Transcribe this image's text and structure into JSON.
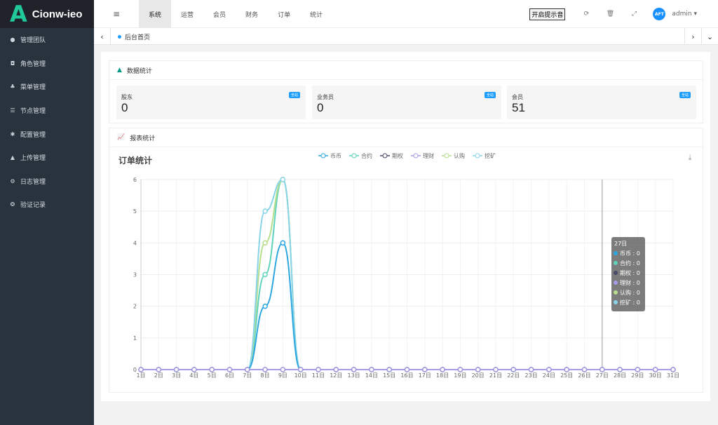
{
  "brand": {
    "mark": "A",
    "name": "Cionw-ieo",
    "color": "#20c997"
  },
  "sidebar": {
    "items": [
      {
        "label": "管理团队",
        "icon": "user-icon",
        "glyph": "●"
      },
      {
        "label": "角色管理",
        "icon": "id-card-icon",
        "glyph": "◘"
      },
      {
        "label": "菜单管理",
        "icon": "tree-icon",
        "glyph": "♣"
      },
      {
        "label": "节点管理",
        "icon": "list-icon",
        "glyph": "☰"
      },
      {
        "label": "配置管理",
        "icon": "asterisk-icon",
        "glyph": "✱"
      },
      {
        "label": "上传管理",
        "icon": "upload-arrow-icon",
        "glyph": "▲"
      },
      {
        "label": "日志管理",
        "icon": "gear-icon",
        "glyph": "⚙"
      },
      {
        "label": "验证记录",
        "icon": "dribbble-icon",
        "glyph": "❂"
      }
    ]
  },
  "header": {
    "menu_icon": "≡",
    "nav": [
      {
        "label": "系统",
        "active": true
      },
      {
        "label": "运营",
        "active": false
      },
      {
        "label": "会员",
        "active": false
      },
      {
        "label": "财务",
        "active": false
      },
      {
        "label": "订单",
        "active": false
      },
      {
        "label": "统计",
        "active": false
      }
    ],
    "sound_button": "开启提示音",
    "refresh_icon": "⟳",
    "trash_icon": "🗑",
    "fullscreen_icon": "⤢",
    "avatar_text": "AFT",
    "user": "admin ▾"
  },
  "tabs": {
    "home": "后台首页",
    "left_arrow": "‹",
    "right_arrow": "›",
    "down_arrow": "⌄"
  },
  "data_panel": {
    "title": "数据统计",
    "stats": [
      {
        "label": "股东",
        "value": "0",
        "badge": "全站"
      },
      {
        "label": "业务员",
        "value": "0",
        "badge": "全站"
      },
      {
        "label": "会员",
        "value": "51",
        "badge": "全站"
      }
    ]
  },
  "report_panel": {
    "title": "报表统计"
  },
  "chart_data": {
    "type": "line",
    "title": "订单统计",
    "categories": [
      "1日",
      "2日",
      "3日",
      "4日",
      "5日",
      "6日",
      "7日",
      "8日",
      "9日",
      "10日",
      "11日",
      "12日",
      "13日",
      "14日",
      "15日",
      "16日",
      "17日",
      "18日",
      "19日",
      "20日",
      "21日",
      "22日",
      "23日",
      "24日",
      "25日",
      "26日",
      "27日",
      "28日",
      "29日",
      "30日",
      "31日"
    ],
    "ylim": [
      0,
      6
    ],
    "yticks": [
      0,
      1,
      2,
      3,
      4,
      5,
      6
    ],
    "grid": true,
    "legend_position": "top",
    "series": [
      {
        "name": "币币",
        "color": "#2ea7e0",
        "values": [
          0,
          0,
          0,
          0,
          0,
          0,
          0,
          2,
          4,
          0,
          0,
          0,
          0,
          0,
          0,
          0,
          0,
          0,
          0,
          0,
          0,
          0,
          0,
          0,
          0,
          0,
          0,
          0,
          0,
          0,
          0
        ]
      },
      {
        "name": "合约",
        "color": "#5fd3bc",
        "values": [
          0,
          0,
          0,
          0,
          0,
          0,
          0,
          3,
          6,
          0,
          0,
          0,
          0,
          0,
          0,
          0,
          0,
          0,
          0,
          0,
          0,
          0,
          0,
          0,
          0,
          0,
          0,
          0,
          0,
          0,
          0
        ]
      },
      {
        "name": "期权",
        "color": "#4a4a6a",
        "values": [
          0,
          0,
          0,
          0,
          0,
          0,
          0,
          0,
          0,
          0,
          0,
          0,
          0,
          0,
          0,
          0,
          0,
          0,
          0,
          0,
          0,
          0,
          0,
          0,
          0,
          0,
          0,
          0,
          0,
          0,
          0
        ]
      },
      {
        "name": "理财",
        "color": "#a89ce8",
        "values": [
          0,
          0,
          0,
          0,
          0,
          0,
          0,
          0,
          0,
          0,
          0,
          0,
          0,
          0,
          0,
          0,
          0,
          0,
          0,
          0,
          0,
          0,
          0,
          0,
          0,
          0,
          0,
          0,
          0,
          0,
          0
        ]
      },
      {
        "name": "认购",
        "color": "#b6de8c",
        "values": [
          0,
          0,
          0,
          0,
          0,
          0,
          0,
          4,
          6,
          0,
          0,
          0,
          0,
          0,
          0,
          0,
          0,
          0,
          0,
          0,
          0,
          0,
          0,
          0,
          0,
          0,
          0,
          0,
          0,
          0,
          0
        ]
      },
      {
        "name": "挖矿",
        "color": "#89d4e8",
        "values": [
          0,
          0,
          0,
          0,
          0,
          0,
          0,
          5,
          6,
          0,
          0,
          0,
          0,
          0,
          0,
          0,
          0,
          0,
          0,
          0,
          0,
          0,
          0,
          0,
          0,
          0,
          0,
          0,
          0,
          0,
          0
        ]
      }
    ],
    "tooltip": {
      "title": "27日",
      "lines": [
        "币币 : 0",
        "合约 : 0",
        "期权 : 0",
        "理财 : 0",
        "认购 : 0",
        "挖矿 : 0"
      ],
      "category_index": 26
    },
    "download_icon": "⤓"
  }
}
